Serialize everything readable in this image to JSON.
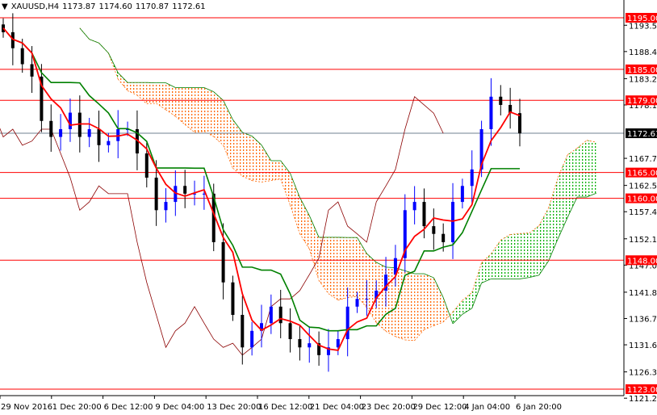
{
  "header": {
    "symbol": "XAUUSD,H4",
    "open": "1173.87",
    "high": "1174.60",
    "low": "1170.87",
    "close": "1172.61"
  },
  "chart_data": {
    "type": "candlestick",
    "title": "XAUUSD,H4",
    "ylim": [
      1121.25,
      1195.0
    ],
    "y_ticks": [
      "1193.55",
      "1188.45",
      "1183.20",
      "1178.10",
      "1167.75",
      "1162.50",
      "1157.40",
      "1152.15",
      "1147.05",
      "1141.80",
      "1136.70",
      "1131.60",
      "1126.35",
      "1121.25"
    ],
    "x_ticks": [
      "29 Nov 2016",
      "1 Dec 20:00",
      "6 Dec 12:00",
      "9 Dec 04:00",
      "13 Dec 20:00",
      "16 Dec 12:00",
      "21 Dec 04:00",
      "23 Dec 20:00",
      "29 Dec 12:00",
      "4 Jan 04:00",
      "6 Jan 20:00"
    ],
    "levels": [
      1195.0,
      1185.0,
      1179.0,
      1165.0,
      1160.0,
      1148.0,
      1123.0
    ],
    "level_labels": [
      "1195.00",
      "1185.00",
      "1179.00",
      "1165.00",
      "1160.00",
      "1148.00",
      "1123.00"
    ],
    "current_price": 1172.61,
    "current_price_label": "1172.61",
    "closes": [
      1192.2,
      1189.1,
      1186.0,
      1183.6,
      1175.0,
      1171.9,
      1173.4,
      1176.6,
      1171.9,
      1173.4,
      1170.3,
      1171.1,
      1173.4,
      1173.4,
      1168.7,
      1164.0,
      1157.7,
      1159.3,
      1162.4,
      1160.9,
      1160.9,
      1160.9,
      1151.5,
      1143.7,
      1137.4,
      1131.1,
      1134.3,
      1135.8,
      1139.0,
      1135.8,
      1132.7,
      1131.1,
      1131.9,
      1129.6,
      1131.1,
      1132.7,
      1139.0,
      1140.5,
      1140.5,
      1142.1,
      1145.2,
      1148.4,
      1157.7,
      1159.3,
      1154.6,
      1153.1,
      1151.5,
      1159.3,
      1162.4,
      1165.6,
      1173.4,
      1179.7,
      1178.1,
      1176.5,
      1172.6
    ],
    "colors": {
      "bull": "#0000ff",
      "bear": "#000000",
      "tenkan": "#ff0000",
      "kijun": "#008000",
      "chikou": "#8b0000",
      "cloud_bear": "#ff6600",
      "cloud_bull": "#00b000",
      "level": "#ff0000",
      "current": "#000000"
    }
  }
}
